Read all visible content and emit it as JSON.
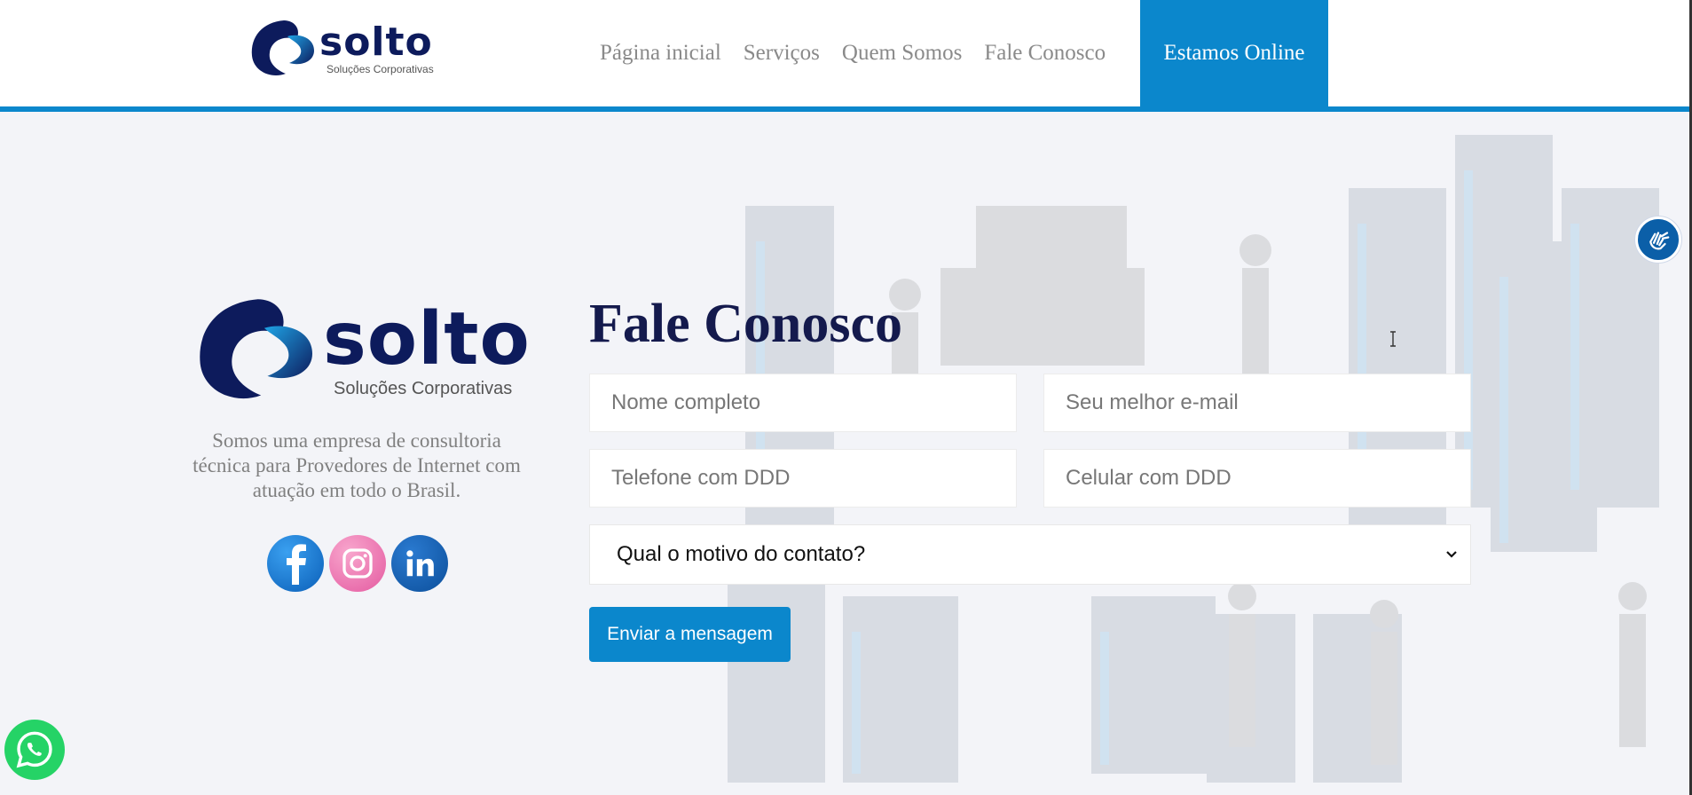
{
  "header": {
    "logo": {
      "word": "solto",
      "sub": "Soluções Corporativas"
    },
    "nav": [
      {
        "label": "Página inicial"
      },
      {
        "label": "Serviços"
      },
      {
        "label": "Quem Somos"
      },
      {
        "label": "Fale Conosco"
      }
    ],
    "online_label": "Estamos Online"
  },
  "about": {
    "logo": {
      "word": "solto",
      "sub": "Soluções Corporativas"
    },
    "text": "Somos uma empresa de consultoria técnica para Provedores de Internet com atuação em todo o Brasil.",
    "socials": [
      {
        "name": "facebook-icon"
      },
      {
        "name": "instagram-icon"
      },
      {
        "name": "linkedin-icon"
      }
    ]
  },
  "form": {
    "title": "Fale Conosco",
    "name_placeholder": "Nome completo",
    "email_placeholder": "Seu melhor e-mail",
    "phone_placeholder": "Telefone com DDD",
    "mobile_placeholder": "Celular com DDD",
    "reason_selected": "Qual o motivo do contato?",
    "submit_label": "Enviar a mensagem"
  },
  "widgets": {
    "accessibility_icon": "sign-language-icon",
    "whatsapp_icon": "whatsapp-icon"
  },
  "colors": {
    "brand_blue": "#0b87cc",
    "brand_navy": "#141a4d",
    "background": "#f3f4f8"
  }
}
